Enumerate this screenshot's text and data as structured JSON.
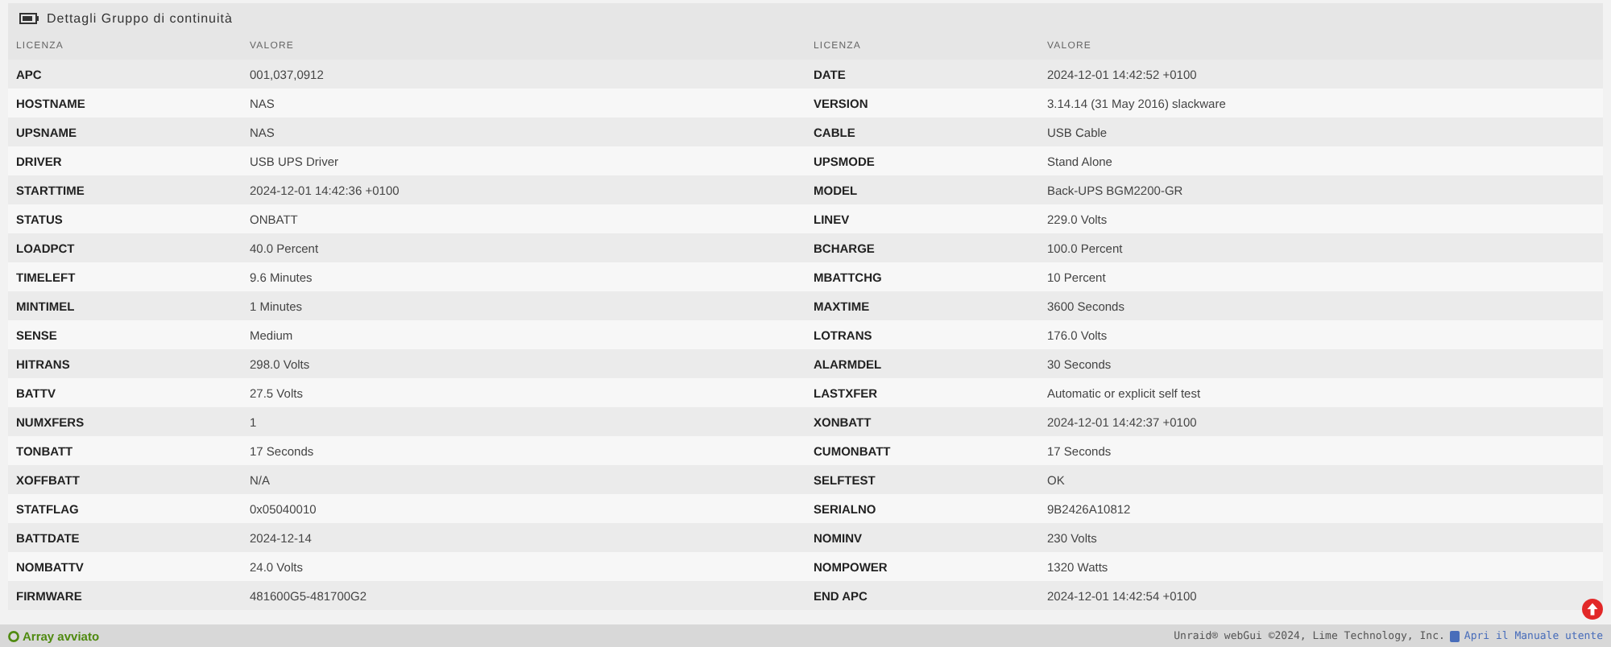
{
  "panel": {
    "title": "Dettagli Gruppo di continuità"
  },
  "tables": [
    {
      "columns": [
        "LICENZA",
        "VALORE"
      ],
      "rows": [
        {
          "name": "APC",
          "value": "001,037,0912"
        },
        {
          "name": "HOSTNAME",
          "value": "NAS"
        },
        {
          "name": "UPSNAME",
          "value": "NAS"
        },
        {
          "name": "DRIVER",
          "value": "USB UPS Driver"
        },
        {
          "name": "STARTTIME",
          "value": "2024-12-01 14:42:36 +0100"
        },
        {
          "name": "STATUS",
          "value": "ONBATT"
        },
        {
          "name": "LOADPCT",
          "value": "40.0 Percent"
        },
        {
          "name": "TIMELEFT",
          "value": "9.6 Minutes"
        },
        {
          "name": "MINTIMEL",
          "value": "1 Minutes"
        },
        {
          "name": "SENSE",
          "value": "Medium"
        },
        {
          "name": "HITRANS",
          "value": "298.0 Volts"
        },
        {
          "name": "BATTV",
          "value": "27.5 Volts"
        },
        {
          "name": "NUMXFERS",
          "value": "1"
        },
        {
          "name": "TONBATT",
          "value": "17 Seconds"
        },
        {
          "name": "XOFFBATT",
          "value": "N/A"
        },
        {
          "name": "STATFLAG",
          "value": "0x05040010"
        },
        {
          "name": "BATTDATE",
          "value": "2024-12-14"
        },
        {
          "name": "NOMBATTV",
          "value": "24.0 Volts"
        },
        {
          "name": "FIRMWARE",
          "value": "481600G5-481700G2"
        }
      ]
    },
    {
      "columns": [
        "LICENZA",
        "VALORE"
      ],
      "rows": [
        {
          "name": "DATE",
          "value": "2024-12-01 14:42:52 +0100"
        },
        {
          "name": "VERSION",
          "value": "3.14.14 (31 May 2016) slackware"
        },
        {
          "name": "CABLE",
          "value": "USB Cable"
        },
        {
          "name": "UPSMODE",
          "value": "Stand Alone"
        },
        {
          "name": "MODEL",
          "value": "Back-UPS BGM2200-GR"
        },
        {
          "name": "LINEV",
          "value": "229.0 Volts"
        },
        {
          "name": "BCHARGE",
          "value": "100.0 Percent"
        },
        {
          "name": "MBATTCHG",
          "value": "10 Percent"
        },
        {
          "name": "MAXTIME",
          "value": "3600 Seconds"
        },
        {
          "name": "LOTRANS",
          "value": "176.0 Volts"
        },
        {
          "name": "ALARMDEL",
          "value": "30 Seconds"
        },
        {
          "name": "LASTXFER",
          "value": "Automatic or explicit self test"
        },
        {
          "name": "XONBATT",
          "value": "2024-12-01 14:42:37 +0100"
        },
        {
          "name": "CUMONBATT",
          "value": "17 Seconds"
        },
        {
          "name": "SELFTEST",
          "value": "OK"
        },
        {
          "name": "SERIALNO",
          "value": "9B2426A10812"
        },
        {
          "name": "NOMINV",
          "value": "230 Volts"
        },
        {
          "name": "NOMPOWER",
          "value": "1320 Watts"
        },
        {
          "name": "END APC",
          "value": "2024-12-01 14:42:54 +0100"
        }
      ]
    }
  ],
  "status_bar": {
    "array_status": "Array avviato",
    "copyright": "Unraid® webGui ©2024, Lime Technology, Inc.",
    "manual_link": "Apri il Manuale utente"
  }
}
